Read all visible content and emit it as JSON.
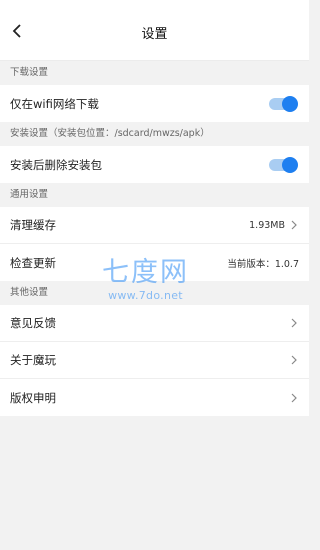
{
  "header": {
    "title": "设置",
    "back_icon": "chevron-left-icon"
  },
  "sections": {
    "download": {
      "label": "下载设置",
      "wifi_only": {
        "label": "仅在wifi网络下载",
        "enabled": true
      }
    },
    "install": {
      "label": "安装设置（安装包位置：/sdcard/mwzs/apk）",
      "delete_after": {
        "label": "安装后删除安装包",
        "enabled": true
      }
    },
    "general": {
      "label": "通用设置",
      "clear_cache": {
        "label": "清理缓存",
        "value": "1.93MB"
      },
      "check_update": {
        "label": "检查更新",
        "value": "当前版本：1.0.7"
      }
    },
    "other": {
      "label": "其他设置",
      "feedback": {
        "label": "意见反馈"
      },
      "about": {
        "label": "关于魔玩"
      },
      "copyright": {
        "label": "版权申明"
      }
    }
  },
  "watermark": {
    "logo": "七度网",
    "url": "www.7do.net"
  },
  "colors": {
    "accent": "#1e7ff0",
    "toggle_track": "#a9cdf2",
    "background": "#f2f2f2"
  }
}
